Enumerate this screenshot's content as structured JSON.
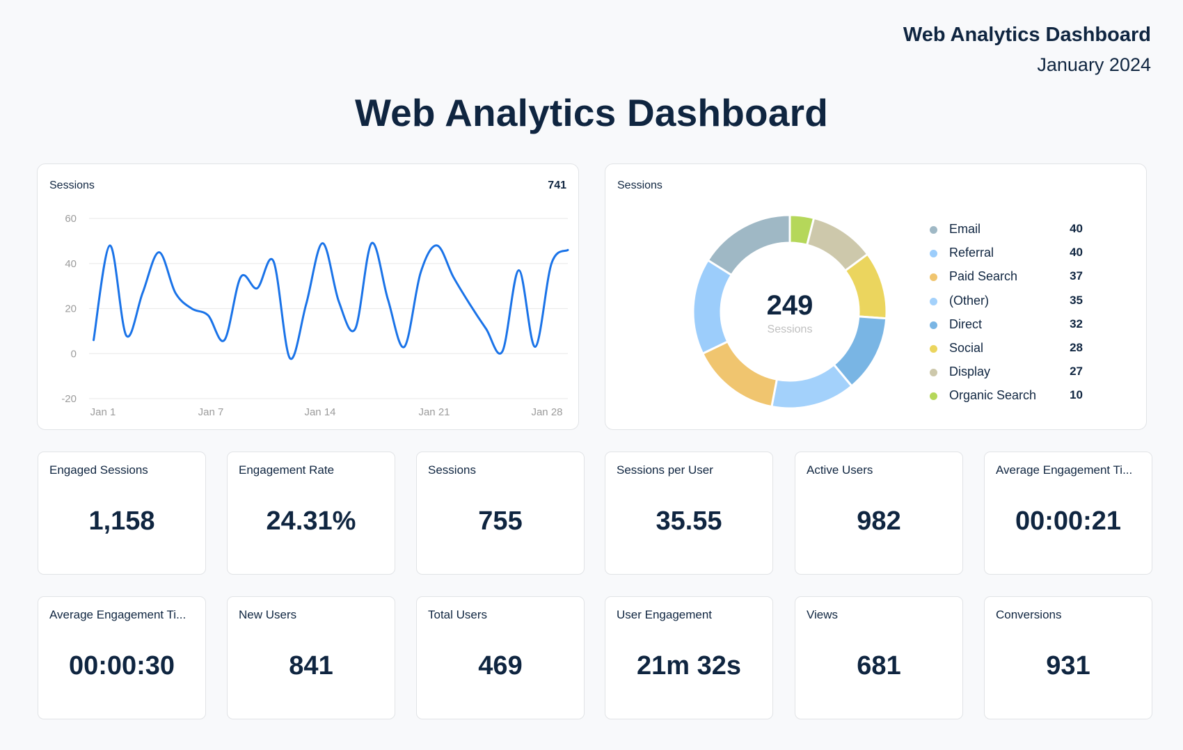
{
  "header": {
    "title": "Web Analytics Dashboard",
    "subtitle": "January 2024"
  },
  "main_title": "Web Analytics Dashboard",
  "colors": {
    "text": "#0f2540",
    "line": "#1a73e8",
    "grid": "#ececec",
    "axis_text": "#9b9b9b"
  },
  "chart_data": [
    {
      "type": "line",
      "title": "Sessions",
      "total": "741",
      "xlabel": "",
      "ylabel": "",
      "ylim": [
        -20,
        60
      ],
      "yticks": [
        60,
        40,
        20,
        0,
        -20
      ],
      "grid": true,
      "x_tick_labels": [
        "Jan 1",
        "Jan 7",
        "Jan 14",
        "Jan 21",
        "Jan 28"
      ],
      "x": [
        "Jan 1",
        "Jan 2",
        "Jan 3",
        "Jan 4",
        "Jan 5",
        "Jan 6",
        "Jan 7",
        "Jan 8",
        "Jan 9",
        "Jan 10",
        "Jan 11",
        "Jan 12",
        "Jan 13",
        "Jan 14",
        "Jan 15",
        "Jan 16",
        "Jan 17",
        "Jan 18",
        "Jan 19",
        "Jan 20",
        "Jan 21",
        "Jan 22",
        "Jan 23",
        "Jan 24",
        "Jan 25",
        "Jan 26",
        "Jan 27",
        "Jan 28",
        "Jan 29",
        "Jan 30"
      ],
      "series": [
        {
          "name": "Sessions",
          "color": "#1a73e8",
          "values": [
            6,
            48,
            8,
            27,
            45,
            27,
            20,
            17,
            6,
            34,
            29,
            41,
            -2,
            22,
            49,
            23,
            11,
            49,
            24,
            3,
            36,
            48,
            34,
            22,
            11,
            1,
            37,
            3,
            40,
            46
          ]
        }
      ]
    },
    {
      "type": "pie",
      "title": "Sessions",
      "center_value": "249",
      "center_label": "Sessions",
      "legend": "right",
      "categories": [
        "Email",
        "Referral",
        "Paid Search",
        "(Other)",
        "Direct",
        "Social",
        "Display",
        "Organic Search"
      ],
      "values": [
        40,
        40,
        37,
        35,
        32,
        28,
        27,
        10
      ],
      "colors": [
        "#9fb8c5",
        "#9ccdfb",
        "#f0c56f",
        "#a3d1fb",
        "#79b5e4",
        "#ebd55e",
        "#cdc8ab",
        "#b5d75a"
      ]
    }
  ],
  "kpis": [
    {
      "label": "Engaged Sessions",
      "value": "1,158"
    },
    {
      "label": "Engagement Rate",
      "value": "24.31%"
    },
    {
      "label": "Sessions",
      "value": "755"
    },
    {
      "label": "Sessions per User",
      "value": "35.55"
    },
    {
      "label": "Active Users",
      "value": "982"
    },
    {
      "label": "Average Engagement Ti...",
      "value": "00:00:21"
    },
    {
      "label": "Average Engagement Ti...",
      "value": "00:00:30"
    },
    {
      "label": "New Users",
      "value": "841"
    },
    {
      "label": "Total Users",
      "value": "469"
    },
    {
      "label": "User Engagement",
      "value": "21m 32s"
    },
    {
      "label": "Views",
      "value": "681"
    },
    {
      "label": "Conversions",
      "value": "931"
    }
  ]
}
